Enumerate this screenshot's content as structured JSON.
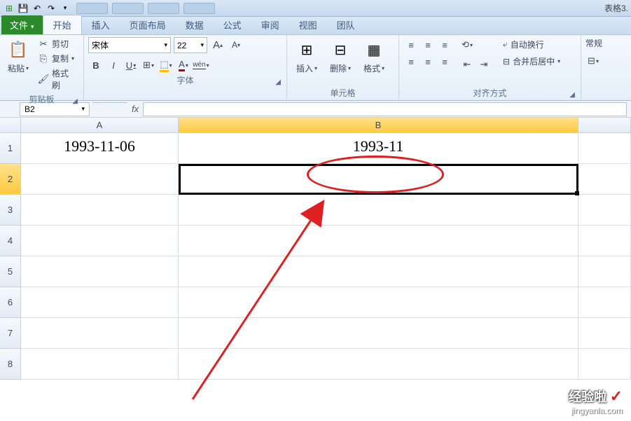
{
  "title_right": "表格3.",
  "qat": {
    "save": "💾",
    "undo": "↶",
    "redo": "↷"
  },
  "tabs": {
    "file": "文件",
    "home": "开始",
    "insert": "插入",
    "layout": "页面布局",
    "data": "数据",
    "formula": "公式",
    "review": "审阅",
    "view": "视图",
    "team": "团队"
  },
  "clipboard": {
    "paste": "粘贴",
    "cut": "剪切",
    "copy": "复制",
    "format_painter": "格式刷",
    "group": "剪贴板"
  },
  "font": {
    "name": "宋体",
    "size": "22",
    "bold": "B",
    "italic": "I",
    "underline": "U",
    "group": "字体"
  },
  "cells": {
    "insert": "插入",
    "delete": "删除",
    "format": "格式",
    "group": "单元格"
  },
  "alignment": {
    "wrap": "自动换行",
    "merge": "合并后居中",
    "group": "对齐方式"
  },
  "number": {
    "general": "常规"
  },
  "namebox": "B2",
  "fx": "fx",
  "columns": {
    "a": "A",
    "b": "B"
  },
  "rows": [
    "1",
    "2",
    "3",
    "4",
    "5",
    "6",
    "7",
    "8"
  ],
  "data": {
    "a1": "1993-11-06",
    "b1": "1993-11"
  },
  "watermark": {
    "line1": "经验啦",
    "check": "✓",
    "line2": "jingyanla.com"
  }
}
